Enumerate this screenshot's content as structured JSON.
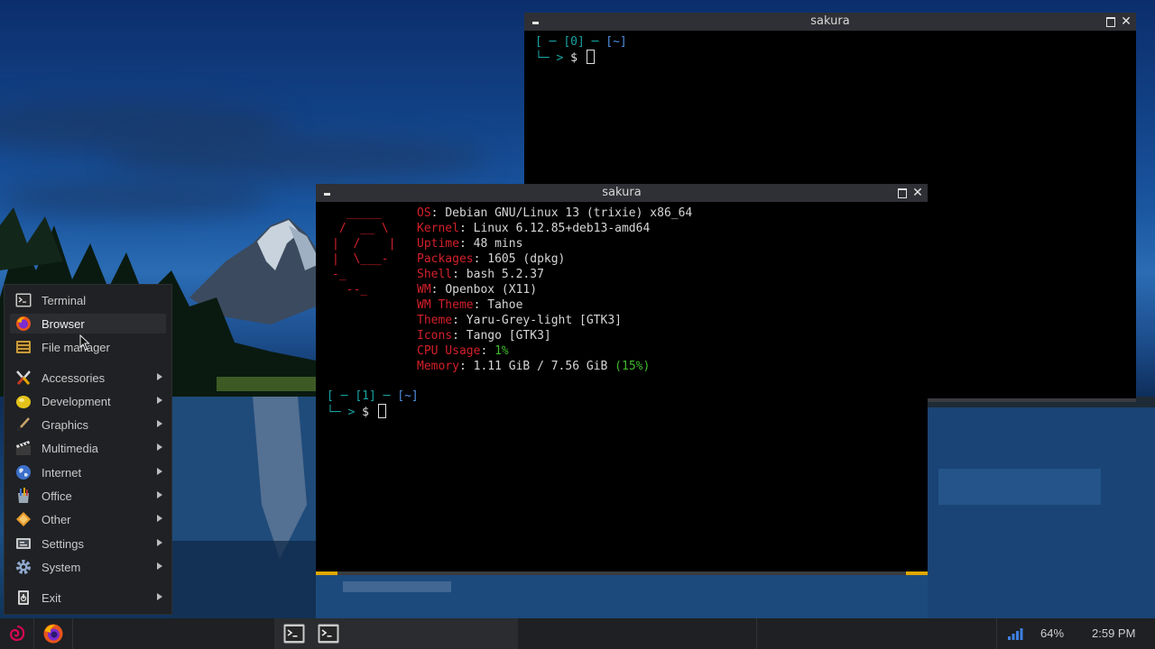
{
  "windows": {
    "back": {
      "title": "sakura",
      "prompt_line1": {
        "open": "[ ",
        "dash": "─",
        "num": "[0]",
        "sep": " ─ ",
        "dir": "[~]"
      },
      "prompt_line2": {
        "open": "└",
        "dash": "─",
        "gt": " > ",
        "dollar": "$ "
      }
    },
    "front": {
      "title": "sakura",
      "logo_lines": [
        "  _____",
        " /  __ \\",
        "|  /    |",
        "|  \\___-",
        "-_",
        "  --_"
      ],
      "info": [
        {
          "key": "OS",
          "value": "Debian GNU/Linux 13 (trixie) x86_64"
        },
        {
          "key": "Kernel",
          "value": "Linux 6.12.85+deb13-amd64"
        },
        {
          "key": "Uptime",
          "value": "48 mins"
        },
        {
          "key": "Packages",
          "value": "1605 (dpkg)"
        },
        {
          "key": "Shell",
          "value": "bash 5.2.37"
        },
        {
          "key": "WM",
          "value": "Openbox (X11)"
        },
        {
          "key": "WM Theme",
          "value": "Tahoe"
        },
        {
          "key": "Theme",
          "value": "Yaru-Grey-light [GTK3]"
        },
        {
          "key": "Icons",
          "value": "Tango [GTK3]"
        },
        {
          "key": "CPU Usage",
          "value": "1%"
        },
        {
          "key": "Memory",
          "value": "1.11 GiB / 7.56 GiB",
          "percent": "(15%)"
        }
      ],
      "prompt_num": "[1]",
      "prompt_dir": "[~]"
    }
  },
  "menu": {
    "items": [
      {
        "label": "Terminal",
        "icon": "terminal-icon",
        "submenu": false
      },
      {
        "label": "Browser",
        "icon": "firefox-icon",
        "submenu": false
      },
      {
        "label": "File manager",
        "icon": "file-manager-icon",
        "submenu": false
      },
      {
        "label": "Accessories",
        "icon": "accessories-icon",
        "submenu": true
      },
      {
        "label": "Development",
        "icon": "development-icon",
        "submenu": true
      },
      {
        "label": "Graphics",
        "icon": "graphics-icon",
        "submenu": true
      },
      {
        "label": "Multimedia",
        "icon": "multimedia-icon",
        "submenu": true
      },
      {
        "label": "Internet",
        "icon": "internet-icon",
        "submenu": true
      },
      {
        "label": "Office",
        "icon": "office-icon",
        "submenu": true
      },
      {
        "label": "Other",
        "icon": "other-icon",
        "submenu": true
      },
      {
        "label": "Settings",
        "icon": "settings-icon",
        "submenu": true
      },
      {
        "label": "System",
        "icon": "system-icon",
        "submenu": true
      },
      {
        "label": "Exit",
        "icon": "exit-icon",
        "submenu": true
      }
    ]
  },
  "taskbar": {
    "volume": "64%",
    "clock": "2:59 PM"
  },
  "colors": {
    "accent": "#e0a800",
    "fetch_key": "#d4202a",
    "prompt_cyan": "#17a3a3",
    "prompt_blue": "#4f8fe0",
    "usage_green": "#3fbb2b"
  }
}
